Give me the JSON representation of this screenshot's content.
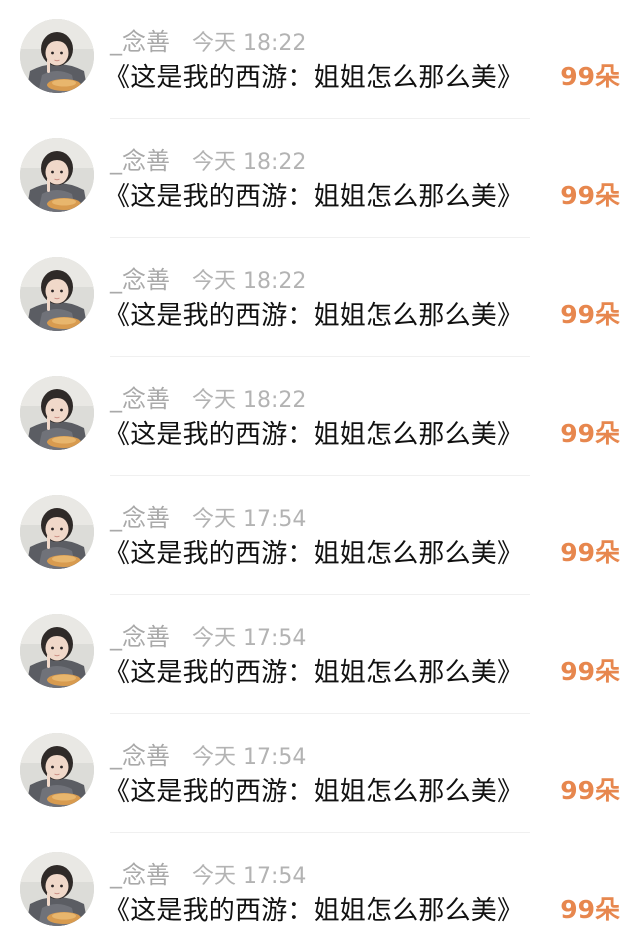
{
  "icons": {
    "avatar": "user-avatar-photo-icon"
  },
  "colors": {
    "username": "#a9a9a9",
    "timestamp": "#b3b3b3",
    "message": "#111111",
    "count_accent": "#e7874e"
  },
  "gifts": [
    {
      "username": "_念善",
      "time": "今天 18:22",
      "message": "《这是我的西游：姐姐怎么那么美》",
      "count": "99朵"
    },
    {
      "username": "_念善",
      "time": "今天 18:22",
      "message": "《这是我的西游：姐姐怎么那么美》",
      "count": "99朵"
    },
    {
      "username": "_念善",
      "time": "今天 18:22",
      "message": "《这是我的西游：姐姐怎么那么美》",
      "count": "99朵"
    },
    {
      "username": "_念善",
      "time": "今天 18:22",
      "message": "《这是我的西游：姐姐怎么那么美》",
      "count": "99朵"
    },
    {
      "username": "_念善",
      "time": "今天 17:54",
      "message": "《这是我的西游：姐姐怎么那么美》",
      "count": "99朵"
    },
    {
      "username": "_念善",
      "time": "今天 17:54",
      "message": "《这是我的西游：姐姐怎么那么美》",
      "count": "99朵"
    },
    {
      "username": "_念善",
      "time": "今天 17:54",
      "message": "《这是我的西游：姐姐怎么那么美》",
      "count": "99朵"
    },
    {
      "username": "_念善",
      "time": "今天 17:54",
      "message": "《这是我的西游：姐姐怎么那么美》",
      "count": "99朵"
    }
  ]
}
